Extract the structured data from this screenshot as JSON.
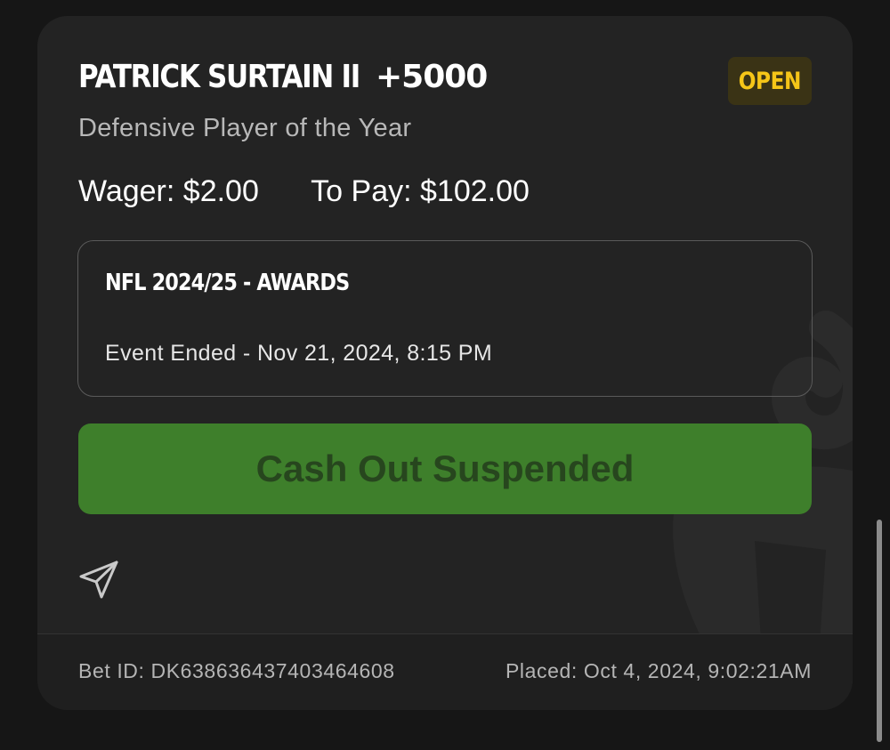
{
  "bet": {
    "selection": "PATRICK SURTAIN II",
    "odds": "+5000",
    "status": "OPEN",
    "market": "Defensive Player of the Year",
    "wager_label": "Wager:",
    "wager_value": "$2.00",
    "topay_label": "To Pay:",
    "topay_value": "$102.00"
  },
  "event": {
    "name": "NFL 2024/25 - AWARDS",
    "status": "Event Ended - Nov 21, 2024, 8:15 PM"
  },
  "actions": {
    "cashout_label": "Cash Out Suspended",
    "share_icon": "share-icon"
  },
  "footer": {
    "bet_id": "Bet ID: DK638636437403464608",
    "placed": "Placed: Oct 4, 2024, 9:02:21AM"
  },
  "colors": {
    "background": "#161616",
    "card": "#232323",
    "status_badge_bg": "#3a3315",
    "status_text": "#f5c518",
    "cashout_bg": "#3e7f2b",
    "cashout_text": "#27461e"
  }
}
